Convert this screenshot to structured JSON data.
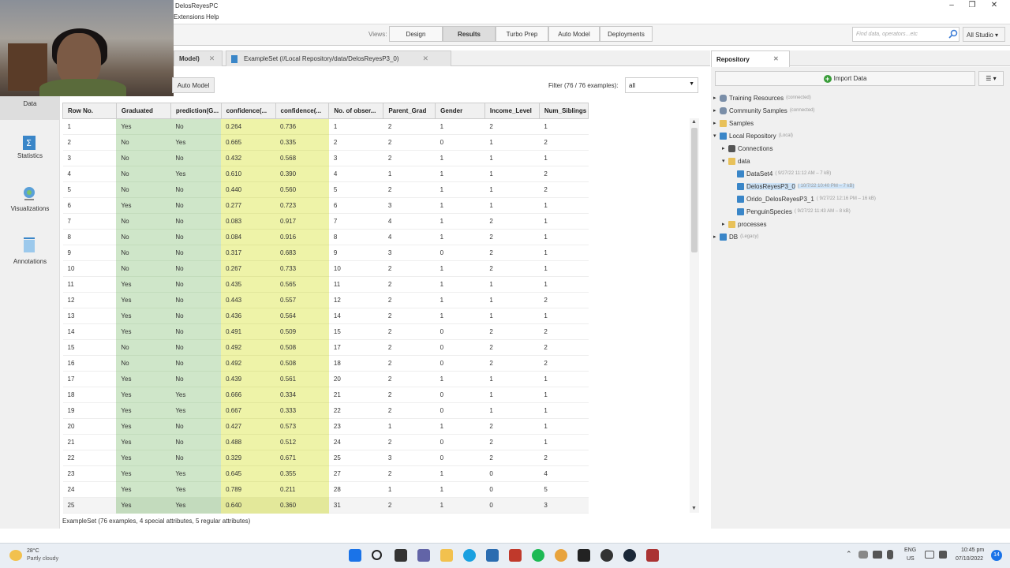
{
  "window": {
    "title": "DelosReyesPC"
  },
  "menu": {
    "items": [
      "Extensions",
      "Help"
    ]
  },
  "toolbar": {
    "views_label": "Views:",
    "views": [
      "Design",
      "Results",
      "Turbo Prep",
      "Auto Model",
      "Deployments"
    ],
    "active_view": "Results",
    "search_placeholder": "Find data, operators...etc",
    "studio_label": "All Studio ▾"
  },
  "left_panel": {
    "items": [
      "Data",
      "Statistics",
      "Visualizations",
      "Annotations"
    ]
  },
  "tabs": [
    {
      "label": "Model)"
    },
    {
      "label": "ExampleSet (//Local Repository/data/DelosReyesP3_0)"
    }
  ],
  "results": {
    "auto_model_label": "Auto Model",
    "filter_label": "Filter (76 / 76 examples):",
    "filter_value": "all",
    "status": "ExampleSet (76 examples, 4 special attributes, 5 regular attributes)",
    "columns": [
      "Row No.",
      "Graduated",
      "prediction(G...",
      "confidence(...",
      "confidence(...",
      "No. of obser...",
      "Parent_Grad",
      "Gender",
      "Income_Level",
      "Num_Siblings"
    ],
    "rows": [
      [
        "1",
        "Yes",
        "No",
        "0.264",
        "0.736",
        "1",
        "2",
        "1",
        "2",
        "1"
      ],
      [
        "2",
        "No",
        "Yes",
        "0.665",
        "0.335",
        "2",
        "2",
        "0",
        "1",
        "2"
      ],
      [
        "3",
        "No",
        "No",
        "0.432",
        "0.568",
        "3",
        "2",
        "1",
        "1",
        "1"
      ],
      [
        "4",
        "No",
        "Yes",
        "0.610",
        "0.390",
        "4",
        "1",
        "1",
        "1",
        "2"
      ],
      [
        "5",
        "No",
        "No",
        "0.440",
        "0.560",
        "5",
        "2",
        "1",
        "1",
        "2"
      ],
      [
        "6",
        "Yes",
        "No",
        "0.277",
        "0.723",
        "6",
        "3",
        "1",
        "1",
        "1"
      ],
      [
        "7",
        "No",
        "No",
        "0.083",
        "0.917",
        "7",
        "4",
        "1",
        "2",
        "1"
      ],
      [
        "8",
        "No",
        "No",
        "0.084",
        "0.916",
        "8",
        "4",
        "1",
        "2",
        "1"
      ],
      [
        "9",
        "No",
        "No",
        "0.317",
        "0.683",
        "9",
        "3",
        "0",
        "2",
        "1"
      ],
      [
        "10",
        "No",
        "No",
        "0.267",
        "0.733",
        "10",
        "2",
        "1",
        "2",
        "1"
      ],
      [
        "11",
        "Yes",
        "No",
        "0.435",
        "0.565",
        "11",
        "2",
        "1",
        "1",
        "1"
      ],
      [
        "12",
        "Yes",
        "No",
        "0.443",
        "0.557",
        "12",
        "2",
        "1",
        "1",
        "2"
      ],
      [
        "13",
        "Yes",
        "No",
        "0.436",
        "0.564",
        "14",
        "2",
        "1",
        "1",
        "1"
      ],
      [
        "14",
        "Yes",
        "No",
        "0.491",
        "0.509",
        "15",
        "2",
        "0",
        "2",
        "2"
      ],
      [
        "15",
        "No",
        "No",
        "0.492",
        "0.508",
        "17",
        "2",
        "0",
        "2",
        "2"
      ],
      [
        "16",
        "No",
        "No",
        "0.492",
        "0.508",
        "18",
        "2",
        "0",
        "2",
        "2"
      ],
      [
        "17",
        "Yes",
        "No",
        "0.439",
        "0.561",
        "20",
        "2",
        "1",
        "1",
        "1"
      ],
      [
        "18",
        "Yes",
        "Yes",
        "0.666",
        "0.334",
        "21",
        "2",
        "0",
        "1",
        "1"
      ],
      [
        "19",
        "Yes",
        "Yes",
        "0.667",
        "0.333",
        "22",
        "2",
        "0",
        "1",
        "1"
      ],
      [
        "20",
        "Yes",
        "No",
        "0.427",
        "0.573",
        "23",
        "1",
        "1",
        "2",
        "1"
      ],
      [
        "21",
        "Yes",
        "No",
        "0.488",
        "0.512",
        "24",
        "2",
        "0",
        "2",
        "1"
      ],
      [
        "22",
        "Yes",
        "No",
        "0.329",
        "0.671",
        "25",
        "3",
        "0",
        "2",
        "2"
      ],
      [
        "23",
        "Yes",
        "Yes",
        "0.645",
        "0.355",
        "27",
        "2",
        "1",
        "0",
        "4"
      ],
      [
        "24",
        "Yes",
        "Yes",
        "0.789",
        "0.211",
        "28",
        "1",
        "1",
        "0",
        "5"
      ],
      [
        "25",
        "Yes",
        "Yes",
        "0.640",
        "0.360",
        "31",
        "2",
        "1",
        "0",
        "3"
      ]
    ]
  },
  "repository": {
    "tab_label": "Repository",
    "import_label": "Import Data",
    "tree": [
      {
        "label": "Training Resources",
        "sub": "(connected)",
        "icon": "cloud",
        "indent": 0,
        "arrow": "▸"
      },
      {
        "label": "Community Samples",
        "sub": "(connected)",
        "icon": "cloud",
        "indent": 0,
        "arrow": "▸"
      },
      {
        "label": "Samples",
        "sub": "",
        "icon": "folder",
        "indent": 0,
        "arrow": "▸"
      },
      {
        "label": "Local Repository",
        "sub": "(Local)",
        "icon": "db",
        "indent": 0,
        "arrow": "▾"
      },
      {
        "label": "Connections",
        "sub": "",
        "icon": "plug",
        "indent": 1,
        "arrow": "▸"
      },
      {
        "label": "data",
        "sub": "",
        "icon": "folder",
        "indent": 1,
        "arrow": "▾"
      },
      {
        "label": "DataSet4",
        "sub": "( 9/27/22 11:12 AM – 7 kB)",
        "icon": "db",
        "indent": 2,
        "arrow": ""
      },
      {
        "label": "DelosReyesP3_0",
        "sub": "( 10/7/22 10:40 PM – 7 kB)",
        "icon": "db",
        "indent": 2,
        "arrow": "",
        "selected": true
      },
      {
        "label": "Orido_DelosReyesP3_1",
        "sub": "( 9/27/22 12:16 PM – 16 kB)",
        "icon": "db",
        "indent": 2,
        "arrow": ""
      },
      {
        "label": "PenguinSpecies",
        "sub": "( 9/27/22 11:43 AM – 8 kB)",
        "icon": "db",
        "indent": 2,
        "arrow": ""
      },
      {
        "label": "processes",
        "sub": "",
        "icon": "folder",
        "indent": 1,
        "arrow": "▸"
      },
      {
        "label": "DB",
        "sub": "(Legacy)",
        "icon": "db",
        "indent": 0,
        "arrow": "▸"
      }
    ]
  },
  "taskbar": {
    "weather_temp": "28°C",
    "weather_desc": "Partly cloudy",
    "lang": "ENG",
    "region": "US",
    "time": "10:45 pm",
    "date": "07/10/2022",
    "badge": "14"
  },
  "colors": {
    "prediction_bg": "#cfe6c9",
    "confidence_bg": "#eef3a8",
    "selected": "#cde3f7"
  }
}
